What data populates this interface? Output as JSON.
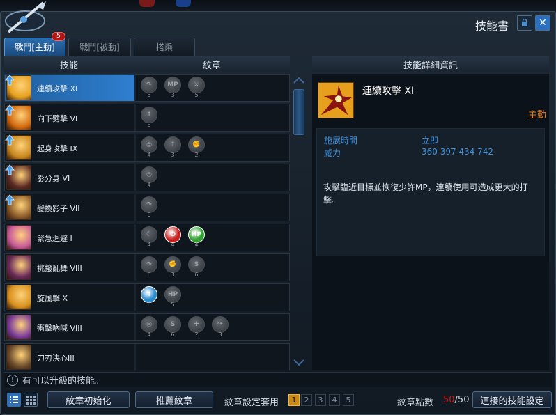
{
  "window": {
    "title": "技能書"
  },
  "tabs": [
    "戰鬥[主動]",
    "戰鬥[被動]",
    "搭乘"
  ],
  "tabs_badge": "5",
  "headers": {
    "skill": "技能",
    "glyph": "紋章",
    "detail": "技能詳細資訊"
  },
  "skills": [
    {
      "name": "連續攻擊 XI",
      "upgradable": true,
      "selected": true,
      "icon_color": "#e6a01e",
      "glyphs": [
        {
          "symbol": "↷",
          "count": "5"
        },
        {
          "symbol": "MP",
          "count": "3"
        },
        {
          "symbol": "⚔",
          "count": "5"
        }
      ]
    },
    {
      "name": "向下劈擊 VI",
      "upgradable": true,
      "selected": false,
      "icon_color": "#d36a10",
      "glyphs": [
        {
          "symbol": "↑",
          "count": "5"
        }
      ]
    },
    {
      "name": "起身攻擊 IX",
      "upgradable": true,
      "selected": false,
      "icon_color": "#c8861e",
      "glyphs": [
        {
          "symbol": "◎",
          "count": "4"
        },
        {
          "symbol": "↑",
          "count": "3"
        },
        {
          "symbol": "✊",
          "count": "2"
        }
      ]
    },
    {
      "name": "影分身 VI",
      "upgradable": true,
      "selected": false,
      "icon_color": "#5a2a24",
      "glyphs": [
        {
          "symbol": "◎",
          "count": "4"
        }
      ]
    },
    {
      "name": "變換影子 VII",
      "upgradable": true,
      "selected": false,
      "icon_color": "#8a5a2a",
      "glyphs": [
        {
          "symbol": "↷",
          "count": "6"
        }
      ]
    },
    {
      "name": "緊急迴避 I",
      "upgradable": false,
      "selected": false,
      "icon_color": "#c85a9a",
      "glyphs": [
        {
          "symbol": "☾",
          "count": "4"
        },
        {
          "symbol": "⏻",
          "count": "4",
          "color": "#c81e1e"
        },
        {
          "symbol": "HP",
          "count": "4",
          "color": "#2fa02f"
        }
      ]
    },
    {
      "name": "挑撥亂舞 VIII",
      "upgradable": false,
      "selected": false,
      "icon_color": "#6a2a5a",
      "glyphs": [
        {
          "symbol": "↷",
          "count": "6"
        },
        {
          "symbol": "✊",
          "count": "3"
        },
        {
          "symbol": "S",
          "count": "6"
        }
      ]
    },
    {
      "name": "旋風擊 X",
      "upgradable": false,
      "selected": false,
      "icon_color": "#d8901e",
      "glyphs": [
        {
          "symbol": "↑",
          "count": "6",
          "color": "#2a8ad0"
        },
        {
          "symbol": "HP",
          "count": "5"
        }
      ]
    },
    {
      "name": "衝擊吶喊 VIII",
      "upgradable": false,
      "selected": false,
      "icon_color": "#7a3a9a",
      "glyphs": [
        {
          "symbol": "◎",
          "count": "4"
        },
        {
          "symbol": "S",
          "count": "6"
        },
        {
          "symbol": "✚",
          "count": "2"
        },
        {
          "symbol": "↷",
          "count": "3"
        }
      ]
    },
    {
      "name": "刀刃決心III",
      "upgradable": false,
      "selected": false,
      "icon_color": "#6a4a2a",
      "glyphs": []
    }
  ],
  "detail": {
    "name": "連續攻擊 XI",
    "type": "主動",
    "cast_label": "施展時間",
    "cast_value": "立即",
    "power_label": "威力",
    "power_value": "360 397 434 742",
    "description": "攻擊臨近目標並恢復少許MP，連續使用可造成更大的打擊。"
  },
  "status_message": "有可以升級的技能。",
  "bottom": {
    "reset_glyphs": "紋章初始化",
    "recommend_glyphs": "推薦紋章",
    "preset_label": "紋章設定套用",
    "presets": [
      "1",
      "2",
      "3",
      "4",
      "5"
    ],
    "points_label": "紋章點數",
    "points_used": "50",
    "points_total": "/50",
    "chain_settings": "連接的技能設定"
  }
}
